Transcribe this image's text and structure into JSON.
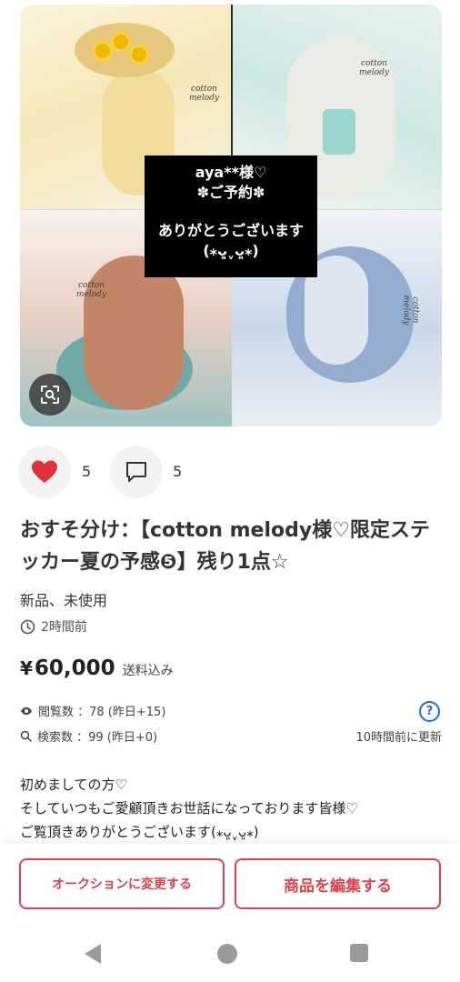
{
  "image": {
    "overlay_line1": "aya**様♡",
    "overlay_line2": "✽ご予約✽",
    "overlay_line3": "ありがとうございます",
    "overlay_line4": "(⁎ᴗ͈ˬᴗ͈⁎)",
    "signature_line1": "cotton",
    "signature_line2": "melody"
  },
  "reactions": {
    "likes": "5",
    "comments": "5"
  },
  "item": {
    "title": "おすそ分け：【cotton melody様♡限定ステッカー夏の予感❺】残り1点☆",
    "condition": "新品、未使用",
    "posted": "2時間前",
    "price_symbol": "¥",
    "price": "60,000",
    "shipping": "送料込み"
  },
  "stats": {
    "views": "閲覧数 ：78 (昨日+15)",
    "searches": "検索数 ：99 (昨日+0)",
    "help": "?",
    "updated": "10時間前に更新"
  },
  "description": {
    "line1": "初めましての方♡",
    "line2": "そしていつもご愛顧頂きお世話になっております皆様♡",
    "line3": "ご覧頂きありがとうございます(⁎ᴗ͈ˬᴗ͈⁎)"
  },
  "actions": {
    "auction": "オークションに変更する",
    "edit": "商品を編集する"
  },
  "colors": {
    "accent": "#e0414a",
    "like": "#e0303a",
    "link": "#1a6fd1"
  }
}
